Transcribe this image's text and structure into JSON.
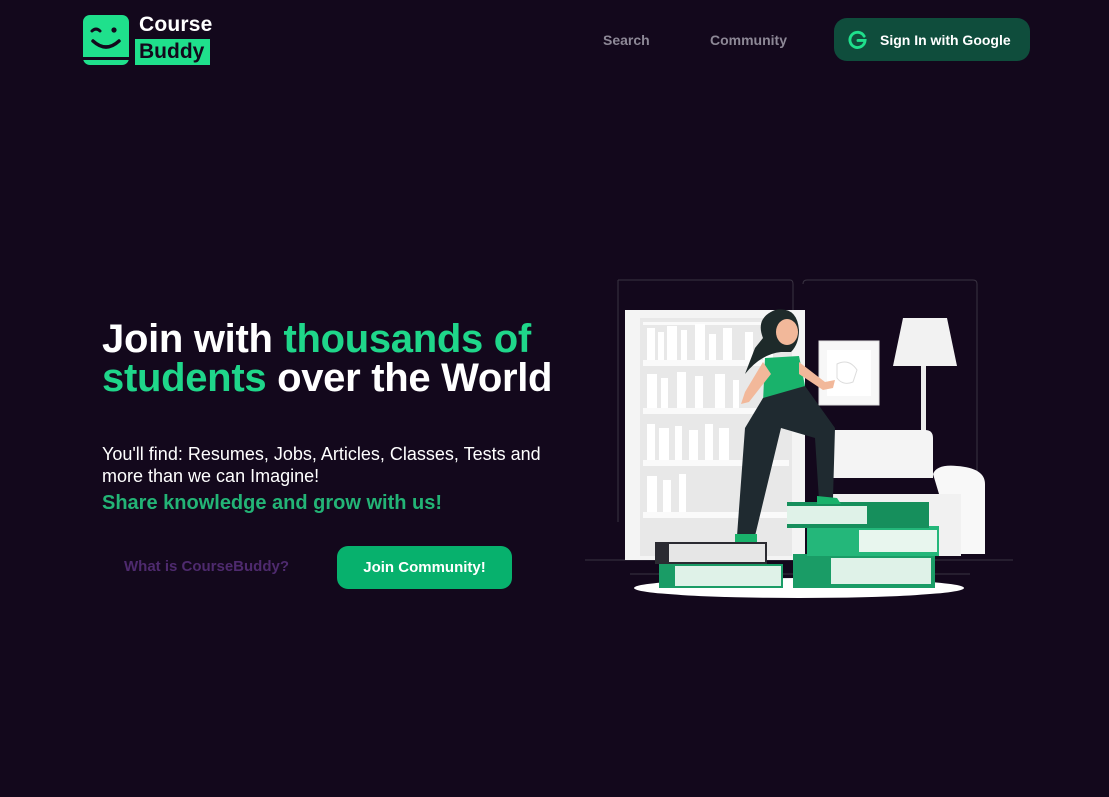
{
  "header": {
    "logo": {
      "top_text": "Course",
      "bottom_text": "Buddy"
    },
    "nav": [
      {
        "label": "Search"
      },
      {
        "label": "Community"
      }
    ],
    "signin": {
      "label": "Sign In with Google",
      "icon": "google-g-icon"
    }
  },
  "hero": {
    "title_part1": "Join with ",
    "title_highlight1": "thousands of students",
    "title_part2": " over the World",
    "subtitle": "You'll find: Resumes, Jobs, Articles, Classes, Tests and more than we can Imagine!",
    "tagline": "Share knowledge and grow with us!",
    "secondary_link": "What is CourseBuddy?",
    "primary_button": "Join Community!"
  },
  "colors": {
    "background": "#13081c",
    "accent": "#1fd68a",
    "button": "#07b16d",
    "signin_bg": "#0f4d3c",
    "nav_text": "#8d8896",
    "secondary_link": "#4e2a6e"
  }
}
